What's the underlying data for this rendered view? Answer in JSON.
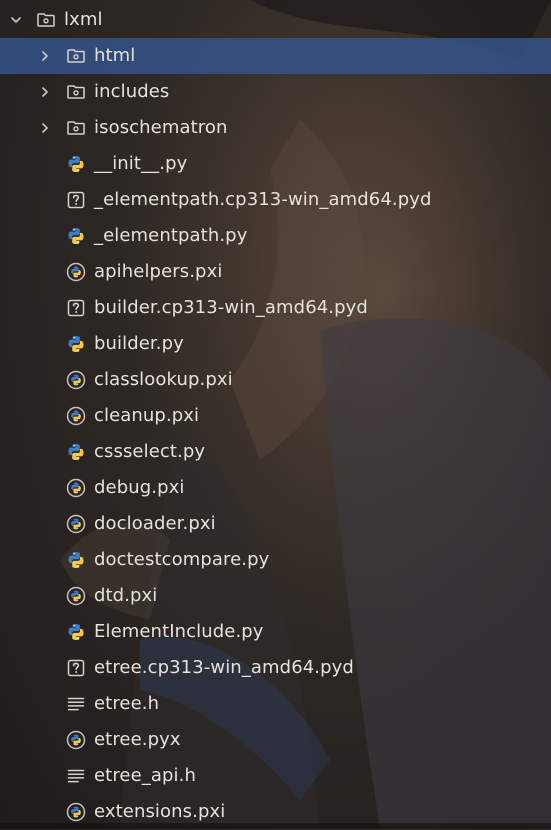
{
  "colors": {
    "selection": "#34548c",
    "text": "#e7e2dc",
    "python_blue": "#3f7cc4",
    "python_yellow": "#f2c94c"
  },
  "tree": {
    "root": {
      "label": "lxml",
      "expanded": true,
      "icon": "folder-icon"
    },
    "items": [
      {
        "label": "html",
        "type": "folder",
        "icon": "folder-icon",
        "collapsed": true,
        "selected": true
      },
      {
        "label": "includes",
        "type": "folder",
        "icon": "folder-icon",
        "collapsed": true
      },
      {
        "label": "isoschematron",
        "type": "folder",
        "icon": "folder-icon",
        "collapsed": true
      },
      {
        "label": "__init__.py",
        "type": "python",
        "icon": "python-icon"
      },
      {
        "label": "_elementpath.cp313-win_amd64.pyd",
        "type": "unknown",
        "icon": "unknown-file-icon"
      },
      {
        "label": "_elementpath.py",
        "type": "python",
        "icon": "python-icon"
      },
      {
        "label": "apihelpers.pxi",
        "type": "cython",
        "icon": "cython-file-icon"
      },
      {
        "label": "builder.cp313-win_amd64.pyd",
        "type": "unknown",
        "icon": "unknown-file-icon"
      },
      {
        "label": "builder.py",
        "type": "python",
        "icon": "python-icon"
      },
      {
        "label": "classlookup.pxi",
        "type": "cython",
        "icon": "cython-file-icon"
      },
      {
        "label": "cleanup.pxi",
        "type": "cython",
        "icon": "cython-file-icon"
      },
      {
        "label": "cssselect.py",
        "type": "python",
        "icon": "python-icon"
      },
      {
        "label": "debug.pxi",
        "type": "cython",
        "icon": "cython-file-icon"
      },
      {
        "label": "docloader.pxi",
        "type": "cython",
        "icon": "cython-file-icon"
      },
      {
        "label": "doctestcompare.py",
        "type": "python",
        "icon": "python-icon"
      },
      {
        "label": "dtd.pxi",
        "type": "cython",
        "icon": "cython-file-icon"
      },
      {
        "label": "ElementInclude.py",
        "type": "python",
        "icon": "python-icon"
      },
      {
        "label": "etree.cp313-win_amd64.pyd",
        "type": "unknown",
        "icon": "unknown-file-icon"
      },
      {
        "label": "etree.h",
        "type": "text",
        "icon": "text-file-icon"
      },
      {
        "label": "etree.pyx",
        "type": "cython",
        "icon": "cython-file-icon"
      },
      {
        "label": "etree_api.h",
        "type": "text",
        "icon": "text-file-icon"
      },
      {
        "label": "extensions.pxi",
        "type": "cython",
        "icon": "cython-file-icon"
      }
    ]
  }
}
